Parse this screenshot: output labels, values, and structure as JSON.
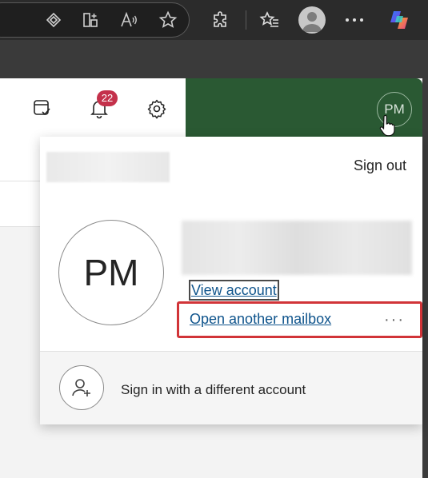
{
  "header": {
    "notification_count": "22",
    "user_initials": "PM"
  },
  "flyout": {
    "sign_out_label": "Sign out",
    "avatar_initials": "PM",
    "view_account_label": "View account",
    "open_mailbox_label": "Open another mailbox",
    "more_options_label": "···",
    "different_account_label": "Sign in with a different account"
  },
  "colors": {
    "header_green": "#2a5933",
    "link_blue": "#0f548c",
    "highlight_red": "#d13438",
    "badge_red": "#c4314b"
  },
  "icons": {
    "browser_toolbar": [
      "app-available-icon",
      "split-screen-icon",
      "read-aloud-icon",
      "favorite-star-icon",
      "extensions-icon",
      "favorites-icon",
      "profile-icon",
      "more-options-icon",
      "copilot-icon"
    ],
    "header": [
      "my-day-icon",
      "notifications-bell-icon",
      "settings-gear-icon"
    ],
    "flyout": [
      "add-user-icon"
    ]
  }
}
